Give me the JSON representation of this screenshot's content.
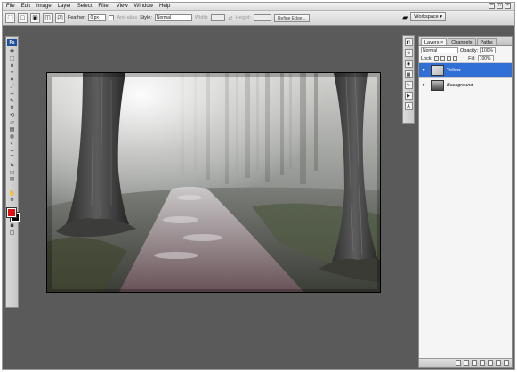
{
  "app": {
    "window_controls": [
      "–",
      "□",
      "×"
    ]
  },
  "menu": [
    "File",
    "Edit",
    "Image",
    "Layer",
    "Select",
    "Filter",
    "View",
    "Window",
    "Help"
  ],
  "options_bar": {
    "feather_label": "Feather:",
    "feather_value": "0 px",
    "antialias_label": "Anti-alias",
    "style_label": "Style:",
    "style_value": "Normal",
    "width_label": "Width:",
    "height_label": "Height:",
    "refine_edge_label": "Refine Edge...",
    "workspace_label": "Workspace ▾"
  },
  "layers_panel": {
    "tabs": [
      "Layers ×",
      "Channels",
      "Paths"
    ],
    "blend_mode": "Normal",
    "opacity_label": "Opacity:",
    "opacity_value": "100%",
    "lock_label": "Lock:",
    "fill_label": "Fill:",
    "fill_value": "100%",
    "layers": [
      {
        "name": "Yellow",
        "selected": true
      },
      {
        "name": "Background",
        "selected": false
      }
    ]
  },
  "colors": {
    "foreground": "#e01010",
    "background": "#000000",
    "selection": "#2f6fd6",
    "workspace": "#5a5a5a"
  }
}
